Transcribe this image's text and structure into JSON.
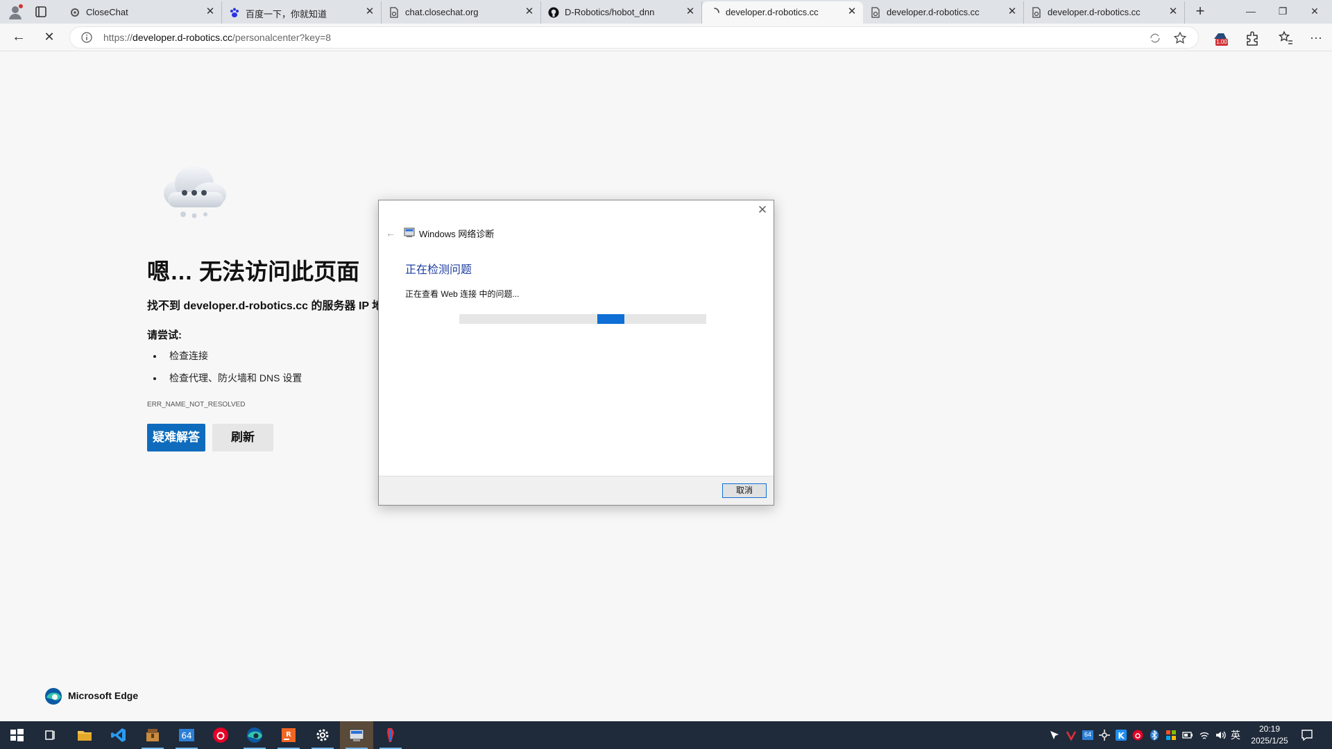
{
  "browser": {
    "tabs": [
      {
        "title": "CloseChat",
        "icon": "gear-icon"
      },
      {
        "title": "百度一下，你就知道",
        "icon": "baidu-paw-icon"
      },
      {
        "title": "chat.closechat.org",
        "icon": "page-icon"
      },
      {
        "title": "D-Robotics/hobot_dnn",
        "icon": "github-icon"
      },
      {
        "title": "developer.d-robotics.cc",
        "icon": "loading-spinner-icon"
      },
      {
        "title": "developer.d-robotics.cc",
        "icon": "page-icon"
      },
      {
        "title": "developer.d-robotics.cc",
        "icon": "page-icon"
      }
    ],
    "active_tab_index": 4,
    "url_prefix": "https://",
    "url_host": "developer.d-robotics.cc",
    "url_path": "/personalcenter?key=8",
    "extension_badge": "1.00"
  },
  "error_page": {
    "title": "嗯… 无法访问此页面",
    "subtitle": "找不到 developer.d-robotics.cc 的服务器 IP 地",
    "try_label": "请尝试:",
    "suggestions": [
      "检查连接",
      "检查代理、防火墙和 DNS 设置"
    ],
    "error_code": "ERR_NAME_NOT_RESOLVED",
    "troubleshoot_button": "疑难解答",
    "refresh_button": "刷新",
    "brand": "Microsoft Edge"
  },
  "dialog": {
    "title": "Windows 网络诊断",
    "heading": "正在检测问题",
    "status": "正在查看 Web 连接 中的问题...",
    "progress_fraction": 0.11,
    "cancel_button": "取消"
  },
  "taskbar": {
    "apps": [
      "start-icon",
      "task-view-icon",
      "file-explorer-icon",
      "vscode-icon",
      "archive-icon",
      "app-64-icon",
      "netease-music-icon",
      "edge-icon",
      "jetbrains-icon",
      "settings-icon",
      "network-diagnostics-icon",
      "hobot-icon"
    ],
    "tray_badge": "64",
    "ime": "英",
    "time": "20:19",
    "date": "2025/1/25"
  },
  "colors": {
    "accent": "#0f6cbd",
    "dialog_heading": "#1e3e9f",
    "progress": "#0f6fd6",
    "taskbar": "#1f2a3a"
  }
}
